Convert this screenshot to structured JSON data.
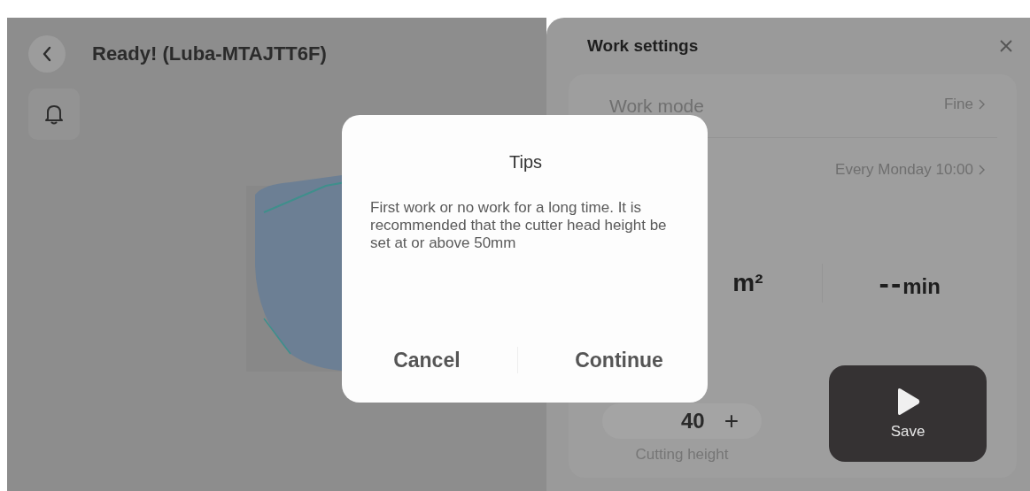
{
  "header": {
    "title": "Ready! (Luba-MTAJTT6F)"
  },
  "work_settings": {
    "title": "Work settings",
    "rows": [
      {
        "label": "Work mode",
        "value": "Fine"
      },
      {
        "value": "Every Monday 10:00"
      }
    ],
    "stats": [
      {
        "unit": "m²"
      },
      {
        "value": "--",
        "unit": "min"
      }
    ],
    "cutting_height": {
      "value": "40",
      "increment": "+",
      "label": "Cutting height"
    },
    "save_button": {
      "label": "Save"
    }
  },
  "dialog": {
    "title": "Tips",
    "message": "First work or no work for a long time. It is recommended that the cutter head height be set at or above 50mm",
    "buttons": [
      "Cancel",
      "Continue"
    ]
  }
}
